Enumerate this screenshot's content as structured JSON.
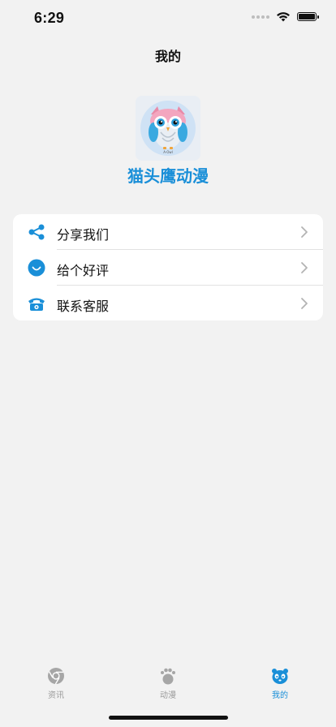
{
  "status_bar": {
    "time": "6:29"
  },
  "nav": {
    "title": "我的"
  },
  "profile": {
    "app_name": "猫头鹰动漫",
    "icon_caption": "A·Owl"
  },
  "menu": {
    "items": [
      {
        "label": "分享我们",
        "icon": "share-icon"
      },
      {
        "label": "给个好评",
        "icon": "smile-icon"
      },
      {
        "label": "联系客服",
        "icon": "phone-icon"
      }
    ]
  },
  "tab_bar": {
    "tabs": [
      {
        "label": "资讯",
        "icon": "chrome-icon",
        "active": false
      },
      {
        "label": "动漫",
        "icon": "footprint-icon",
        "active": false
      },
      {
        "label": "我的",
        "icon": "panda-icon",
        "active": true
      }
    ]
  },
  "colors": {
    "accent": "#1a8fd8",
    "inactive": "#9a9a9a",
    "background": "#f2f2f2"
  }
}
